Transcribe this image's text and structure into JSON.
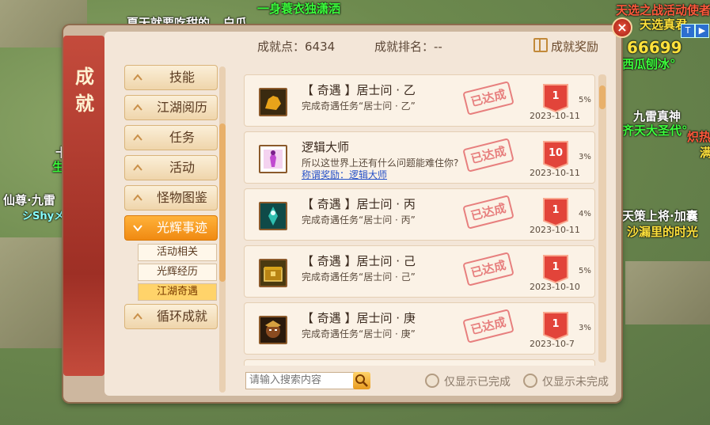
{
  "hud": {
    "top_left_chat": "夏天就要吃甜的",
    "top_left_suffix": "白瓜",
    "top_center": "一身蓑衣独潇洒",
    "top_right_1": "天选之战活动使者",
    "top_right_2": "天选真君",
    "number_right": "66699",
    "right_name_1": "西瓜刨冰°",
    "right_name_2": "九雷真神",
    "right_name_3": "齐天大圣代°",
    "right_name_4": "炽热",
    "right_name_5": "满",
    "left_name_1": "仙尊·九雷",
    "left_name_2": "シShyメ",
    "left_name_3": "十",
    "left_name_4": "生",
    "right_name_6": "天策上将·加囊",
    "right_name_7": "沙漏里的时光",
    "mini_t": "T",
    "mini_arrow": "▶"
  },
  "window": {
    "title": "成就",
    "close": "×",
    "points_label": "成就点：6434",
    "rank_label": "成就排名：--",
    "reward_button": "成就奖励"
  },
  "categories": [
    {
      "label": "技能",
      "active": false
    },
    {
      "label": "江湖阅历",
      "active": false
    },
    {
      "label": "任务",
      "active": false
    },
    {
      "label": "活动",
      "active": false
    },
    {
      "label": "怪物图鉴",
      "active": false
    },
    {
      "label": "光辉事迹",
      "active": true
    },
    {
      "label": "循环成就",
      "active": false
    }
  ],
  "subcategories": [
    {
      "label": "活动相关",
      "active": false
    },
    {
      "label": "光辉经历",
      "active": false
    },
    {
      "label": "江湖奇遇",
      "active": true
    }
  ],
  "entries": [
    {
      "title": "【 奇遇 】居士问 · 乙",
      "desc": "完成奇遇任务“居士问 · 乙”",
      "reward": "",
      "stamp": "已达成",
      "badge": "1",
      "pct": "5%",
      "date": "2023-10-11",
      "icon": "dog-icon",
      "icon_color": "#e8a31a"
    },
    {
      "title": "逻辑大师",
      "desc": "所以这世界上还有什么问题能难住你?",
      "reward": "称谓奖励：逻辑大师",
      "stamp": "已达成",
      "badge": "10",
      "pct": "3%",
      "date": "2023-10-11",
      "icon": "figure-icon",
      "icon_color": "#c04ad0"
    },
    {
      "title": "【 奇遇 】居士问 · 丙",
      "desc": "完成奇遇任务“居士问 · 丙”",
      "reward": "",
      "stamp": "已达成",
      "badge": "1",
      "pct": "4%",
      "date": "2023-10-11",
      "icon": "spirit-icon",
      "icon_color": "#2fbfb0"
    },
    {
      "title": "【 奇遇 】居士问 · 己",
      "desc": "完成奇遇任务“居士问 · 己”",
      "reward": "",
      "stamp": "已达成",
      "badge": "1",
      "pct": "5%",
      "date": "2023-10-10",
      "icon": "treasure-chest-icon",
      "icon_color": "#b88414"
    },
    {
      "title": "【 奇遇 】居士问 · 庚",
      "desc": "完成奇遇任务“居士问 · 庚”",
      "reward": "",
      "stamp": "已达成",
      "badge": "1",
      "pct": "3%",
      "date": "2023-10-7",
      "icon": "warrior-face-icon",
      "icon_color": "#8a4b20"
    }
  ],
  "search": {
    "placeholder": "请输入搜索内容"
  },
  "filters": {
    "completed": "仅显示已完成",
    "incomplete": "仅显示未完成"
  },
  "colors": {
    "accent": "#f08a12",
    "stamp": "#e46c6c",
    "badge": "#e2443a"
  }
}
